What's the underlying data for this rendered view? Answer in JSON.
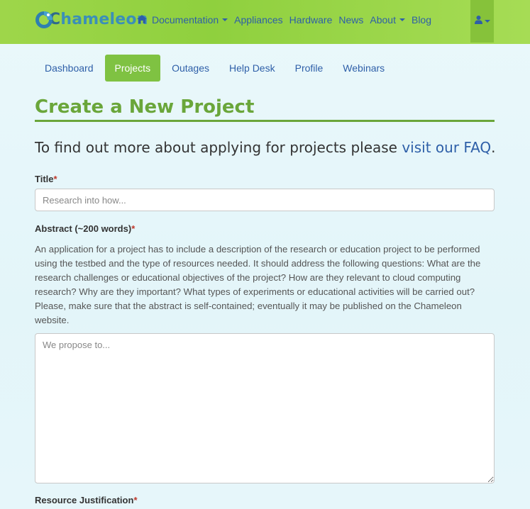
{
  "brand": {
    "logo_c": "C",
    "logo_rest": "hameleon"
  },
  "nav": {
    "items": [
      {
        "label": "Documentation",
        "has_caret": true
      },
      {
        "label": "Appliances",
        "has_caret": false
      },
      {
        "label": "Hardware",
        "has_caret": false
      },
      {
        "label": "News",
        "has_caret": false
      },
      {
        "label": "About",
        "has_caret": true
      },
      {
        "label": "Blog",
        "has_caret": false
      }
    ],
    "home_icon": "home-icon",
    "user_icon": "user-icon"
  },
  "tabs": [
    {
      "label": "Dashboard",
      "active": false
    },
    {
      "label": "Projects",
      "active": true
    },
    {
      "label": "Outages",
      "active": false
    },
    {
      "label": "Help Desk",
      "active": false
    },
    {
      "label": "Profile",
      "active": false
    },
    {
      "label": "Webinars",
      "active": false
    }
  ],
  "page": {
    "title": "Create a New Project",
    "intro_text": "To find out more about applying for projects please ",
    "intro_link": "visit our FAQ",
    "intro_end": "."
  },
  "form": {
    "title_label": "Title",
    "title_placeholder": "Research into how...",
    "abstract_label": "Abstract (~200 words)",
    "abstract_help": "An application for a project has to include a description of the research or education project to be performed using the testbed and the type of resources needed. It should address the following questions: What are the research challenges or educational objectives of the project? How are they relevant to cloud computing research? Why are they important? What types of experiments or educational activities will be carried out? Please, make sure that the abstract is self-contained; eventually it may be published on the Chameleon website.",
    "abstract_placeholder": "We propose to...",
    "resource_label": "Resource Justification",
    "required_mark": "*"
  },
  "colors": {
    "navbar": "#9ed64a",
    "accent_green": "#6aa63a",
    "tab_active": "#7fc242",
    "link_blue": "#2e5fa8",
    "required_red": "#c0392b"
  }
}
